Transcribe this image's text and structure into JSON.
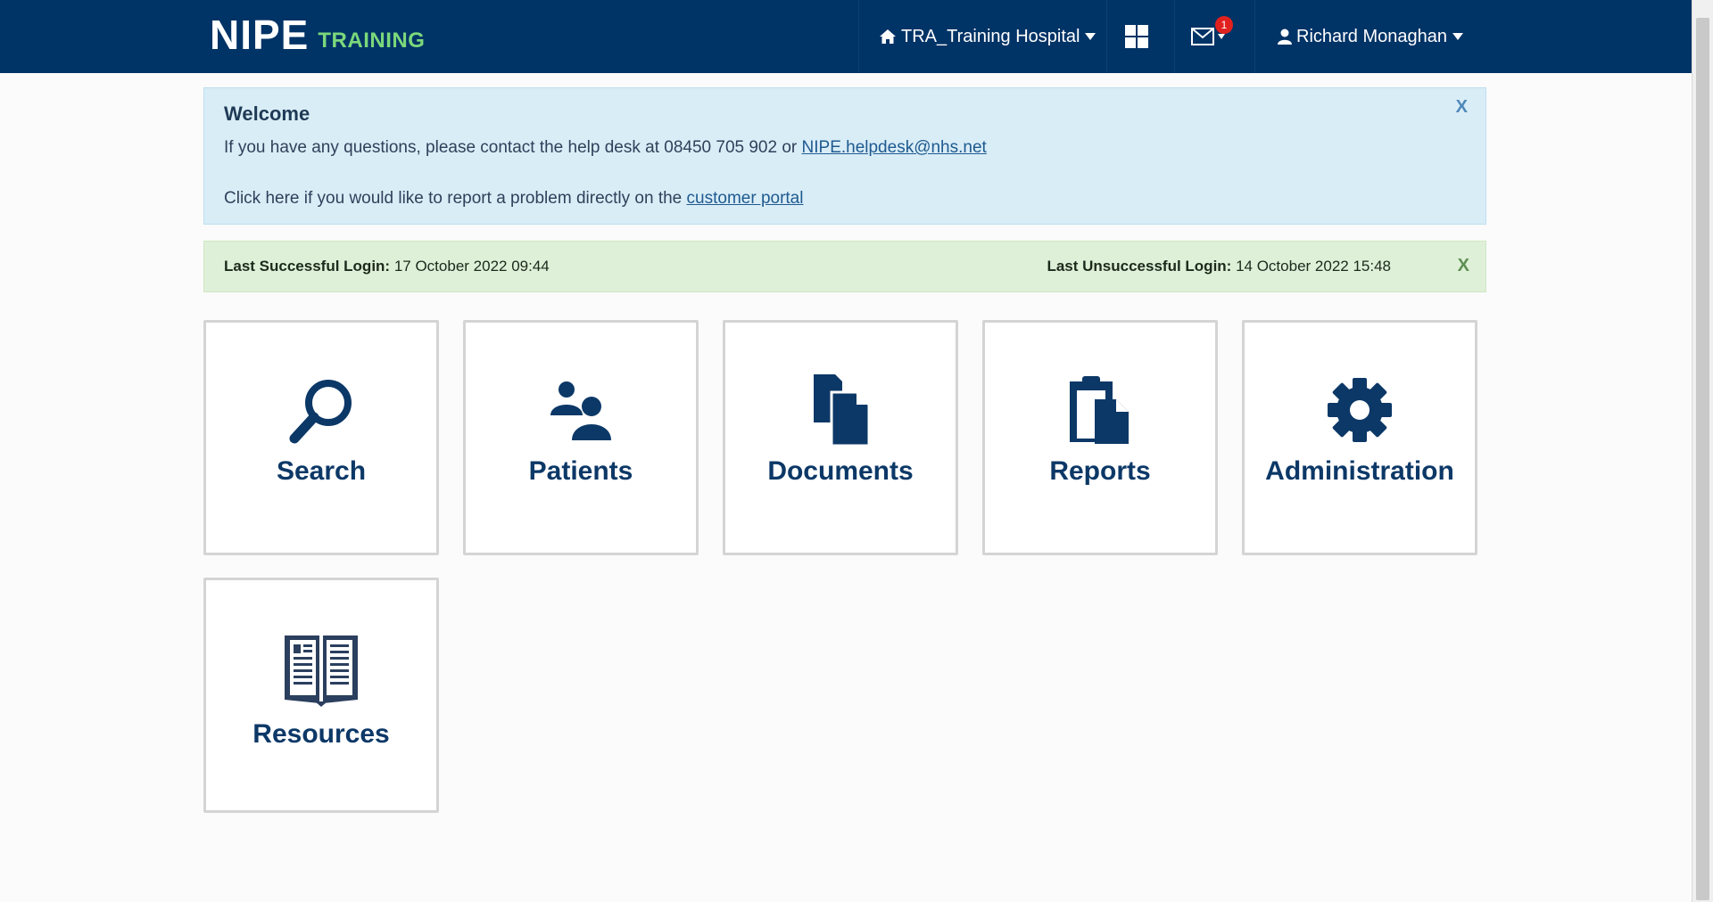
{
  "brand": {
    "name": "NIPE",
    "env": "TRAINING"
  },
  "nav": {
    "hospital": "TRA_Training Hospital",
    "messages_count": "1",
    "user": "Richard Monaghan"
  },
  "welcome": {
    "title": "Welcome",
    "line1_text": "If you have any questions, please contact the help desk at 08450 705 902 or ",
    "email": "NIPE.helpdesk@nhs.net",
    "line2_text": "Click here if you would like to report a problem directly on the ",
    "portal_link": "customer portal",
    "close": "X"
  },
  "login": {
    "success_label": "Last Successful Login:",
    "success_value": "17 October 2022 09:44",
    "fail_label": "Last Unsuccessful Login:",
    "fail_value": "14 October 2022 15:48",
    "close": "X"
  },
  "tiles": [
    {
      "label": "Search",
      "icon": "search-icon"
    },
    {
      "label": "Patients",
      "icon": "patients-icon"
    },
    {
      "label": "Documents",
      "icon": "documents-icon"
    },
    {
      "label": "Reports",
      "icon": "reports-icon"
    },
    {
      "label": "Administration",
      "icon": "gear-icon"
    },
    {
      "label": "Resources",
      "icon": "book-icon"
    }
  ],
  "colors": {
    "header": "#003366",
    "accent": "#7bd87b",
    "tile_text": "#0c3867"
  }
}
